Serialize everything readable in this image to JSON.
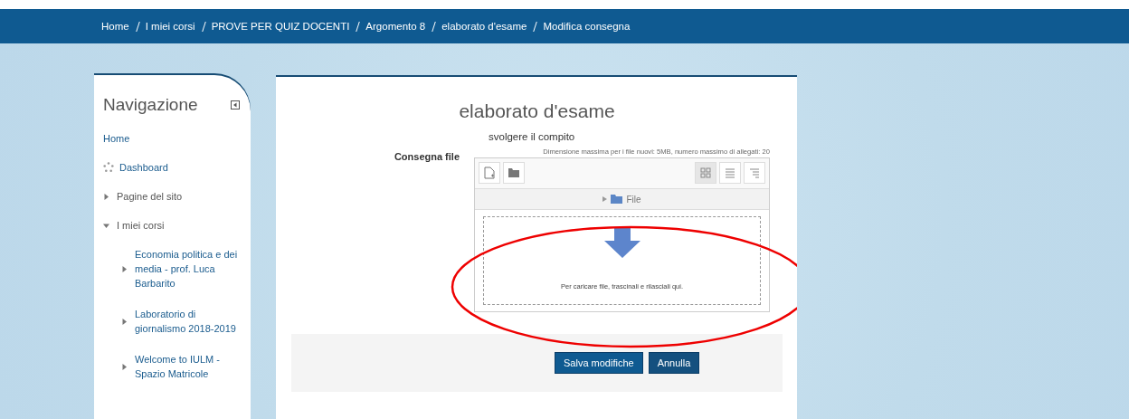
{
  "breadcrumb": [
    "Home",
    "I miei corsi",
    "PROVE PER QUIZ DOCENTI",
    "Argomento 8",
    "elaborato d'esame",
    "Modifica consegna"
  ],
  "navigation": {
    "title": "Navigazione",
    "items": [
      {
        "label": "Home",
        "kind": "link"
      },
      {
        "label": "Dashboard",
        "kind": "icon"
      },
      {
        "label": "Pagine del sito",
        "kind": "branch",
        "expanded": false
      },
      {
        "label": "I miei corsi",
        "kind": "branch",
        "expanded": true,
        "children": [
          {
            "label": "Economia politica e dei media - prof. Luca Barbarito",
            "kind": "branch",
            "expanded": false
          },
          {
            "label": "Laboratorio di giornalismo 2018-2019",
            "kind": "branch",
            "expanded": false
          },
          {
            "label": "Welcome to IULM - Spazio Matricole",
            "kind": "branch",
            "expanded": false
          }
        ]
      }
    ]
  },
  "main": {
    "title": "elaborato d'esame",
    "description": "svolgere il compito",
    "field_label": "Consegna file",
    "limits": "Dimensione massima per i file nuovi: 5MB, numero massimo di allegati: 20",
    "view_modes": [
      {
        "kind": "icons",
        "selected": true
      },
      {
        "kind": "list",
        "selected": false
      },
      {
        "kind": "tree",
        "selected": false
      }
    ],
    "path": "File",
    "drop_hint": "Per caricare file, trascinali e rilasciali qui.",
    "buttons": [
      {
        "label": "Salva modifiche",
        "kind": "primary"
      },
      {
        "label": "Annulla",
        "kind": "secondary"
      }
    ]
  }
}
